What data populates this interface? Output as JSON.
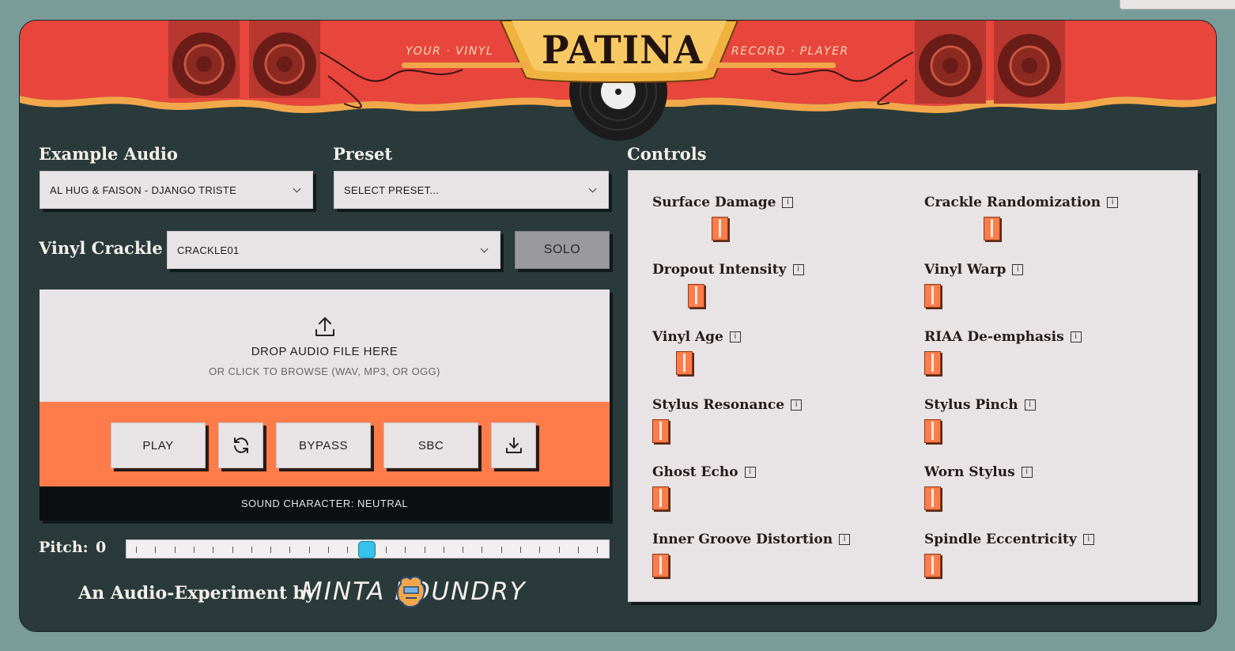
{
  "header": {
    "logo": "PATINA",
    "tagline_left": "YOUR · VINYL",
    "tagline_right": "RECORD · PLAYER"
  },
  "example_audio": {
    "label": "Example Audio",
    "selected": "AL HUG & FAISON - DJANGO TRISTE"
  },
  "preset": {
    "label": "Preset",
    "selected": "SELECT PRESET..."
  },
  "vinyl_crackle": {
    "label": "Vinyl Crackle",
    "selected": "CRACKLE01",
    "solo_label": "SOLO"
  },
  "drop_zone": {
    "title": "DROP AUDIO FILE HERE",
    "subtitle": "OR CLICK TO BROWSE (WAV, MP3, OR OGG)"
  },
  "transport": {
    "play": "PLAY",
    "bypass": "BYPASS",
    "sbc": "SBC"
  },
  "status": "SOUND CHARACTER: NEUTRAL",
  "pitch": {
    "label": "Pitch:",
    "value": "0"
  },
  "footer": {
    "text": "An Audio-Experiment by",
    "brand": "MINTA FOUNDRY"
  },
  "controls": {
    "title": "Controls",
    "info_glyph": "i",
    "items": [
      {
        "name": "Surface Damage",
        "level": 0.5
      },
      {
        "name": "Crackle Randomization",
        "level": 0.5
      },
      {
        "name": "Dropout Intensity",
        "level": 0.3
      },
      {
        "name": "Vinyl Warp",
        "level": 0.0
      },
      {
        "name": "Vinyl Age",
        "level": 0.2
      },
      {
        "name": "RIAA De-emphasis",
        "level": 0.0
      },
      {
        "name": "Stylus Resonance",
        "level": 0.0
      },
      {
        "name": "Stylus Pinch",
        "level": 0.0
      },
      {
        "name": "Ghost Echo",
        "level": 0.0
      },
      {
        "name": "Worn Stylus",
        "level": 0.0
      },
      {
        "name": "Inner Groove Distortion",
        "level": 0.0
      },
      {
        "name": "Spindle Eccentricity",
        "level": 0.0
      }
    ]
  },
  "colors": {
    "accent": "#fd7c4a",
    "header_red": "#e8453c",
    "background": "#2a3a3b",
    "panel": "#e8e3e5",
    "slider_thumb": "#36c2ea"
  }
}
